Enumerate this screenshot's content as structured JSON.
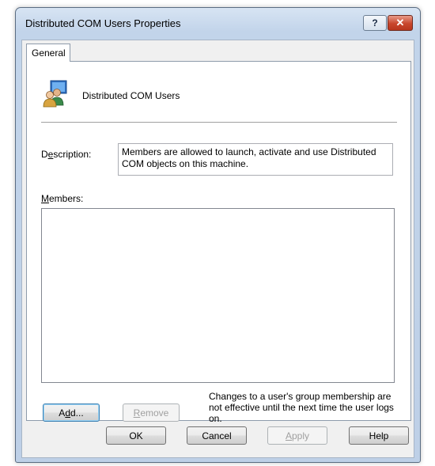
{
  "window": {
    "title": "Distributed COM Users Properties",
    "help_glyph": "?",
    "close_glyph": "✕"
  },
  "tabs": [
    {
      "label": "General",
      "selected": true
    }
  ],
  "group": {
    "name": "Distributed COM Users",
    "icon": "users-group-icon"
  },
  "description": {
    "label": "Description:",
    "value": "Members are allowed to launch, activate and use Distributed COM objects on this machine."
  },
  "members": {
    "label": "Members:",
    "items": []
  },
  "buttons": {
    "add": "Add...",
    "remove": "Remove",
    "ok": "OK",
    "cancel": "Cancel",
    "apply": "Apply",
    "help": "Help"
  },
  "note": "Changes to a user's group membership are not effective until the next time the user logs on.",
  "colors": {
    "title_bar": "#c2d4ea",
    "close_button": "#c8462c",
    "panel_bg": "#ffffff",
    "dialog_bg": "#f0f0f0"
  }
}
